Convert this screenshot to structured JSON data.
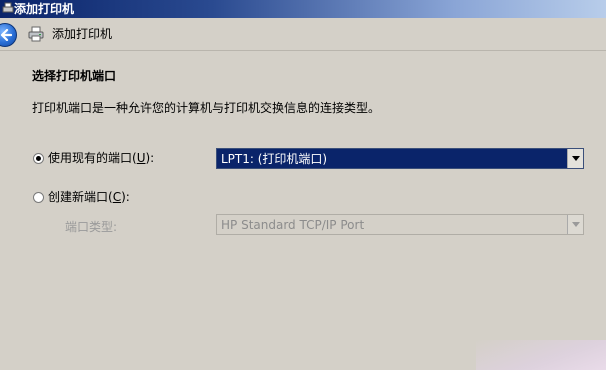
{
  "window": {
    "title": "添加打印机"
  },
  "header": {
    "title": "添加打印机"
  },
  "section": {
    "heading": "选择打印机端口",
    "description": "打印机端口是一种允许您的计算机与打印机交换信息的连接类型。"
  },
  "options": {
    "existing": {
      "label_prefix": "使用现有的端口(",
      "mnemonic": "U",
      "label_suffix": "):",
      "selected_value": "LPT1: (打印机端口)",
      "checked": true
    },
    "create": {
      "label_prefix": "创建新端口(",
      "mnemonic": "C",
      "label_suffix": "):",
      "checked": false,
      "port_type_label": "端口类型:",
      "port_type_value": "HP Standard TCP/IP Port"
    }
  },
  "icons": {
    "back": "back-arrow-icon",
    "printer": "printer-icon"
  },
  "colors": {
    "window_bg": "#d4d0c8",
    "selection": "#0a246a",
    "titlebar": "#0a246a"
  }
}
